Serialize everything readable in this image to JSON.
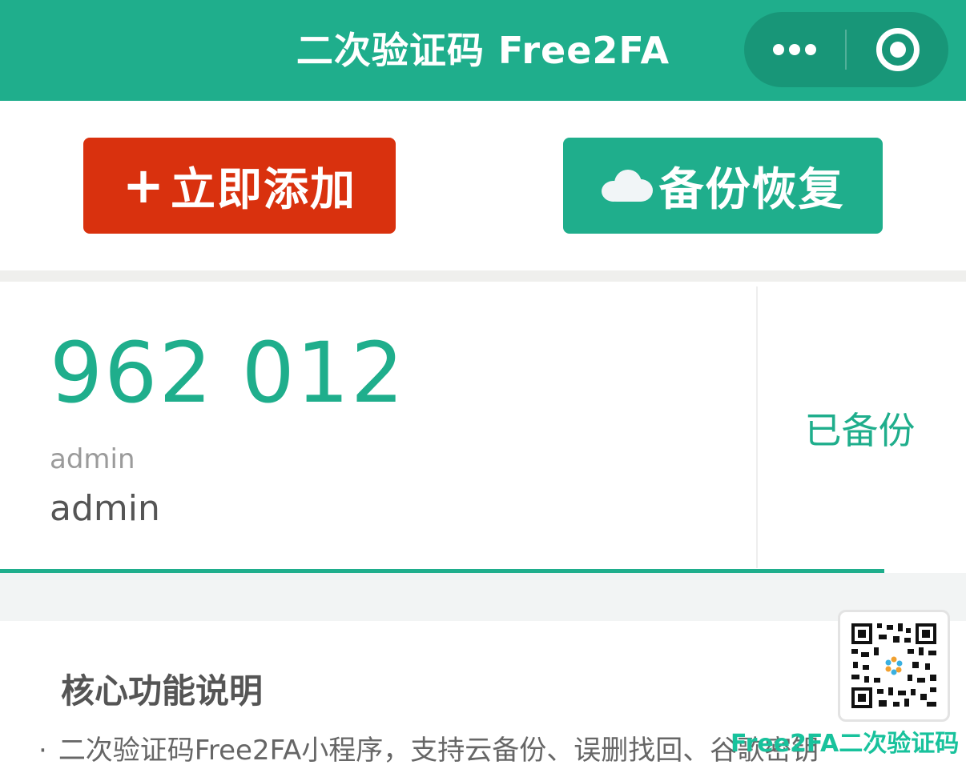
{
  "navbar": {
    "title": "二次验证码 Free2FA",
    "more_icon": "more-dots-icon",
    "close_icon": "target-close-icon"
  },
  "actions": {
    "add_label": "立即添加",
    "add_icon": "plus-icon",
    "backup_label": "备份恢复",
    "backup_icon": "cloud-icon"
  },
  "code_card": {
    "code": "962 012",
    "issuer": "admin",
    "account": "admin",
    "backup_status": "已备份"
  },
  "features": {
    "title": "核心功能说明",
    "line": "二次验证码Free2FA小程序，支持云备份、误删找回、谷歌密钥"
  },
  "watermark": {
    "text": "Free2FA二次验证码"
  },
  "colors": {
    "brand": "#1fae8c",
    "add_button": "#d9310e"
  }
}
